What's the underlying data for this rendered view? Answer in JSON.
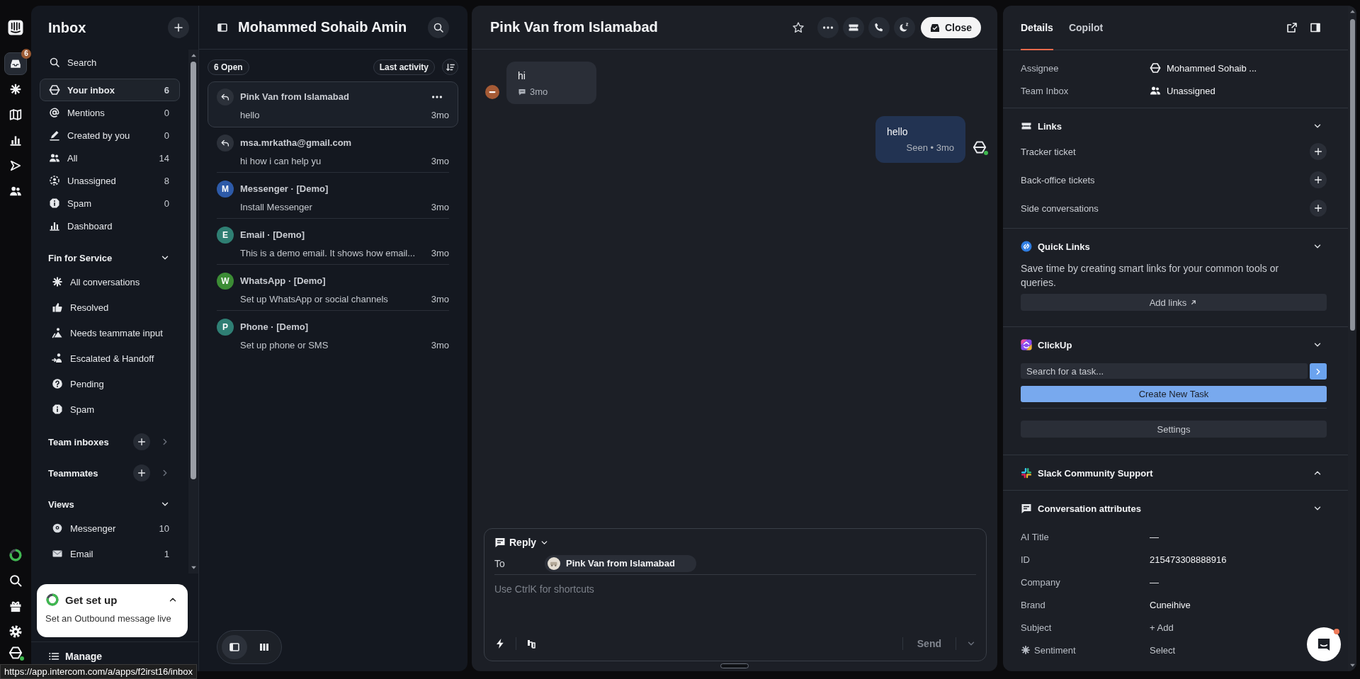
{
  "rail": {
    "top": [
      {
        "selected": true,
        "badge": "6"
      },
      {
        "selected": false
      },
      {
        "selected": false
      },
      {
        "selected": false
      },
      {
        "selected": false
      },
      {
        "selected": false
      }
    ]
  },
  "sidebar": {
    "title": "Inbox",
    "search": "Search",
    "items": [
      {
        "label": "Your inbox",
        "count": "6",
        "selected": true
      },
      {
        "label": "Mentions",
        "count": "0",
        "selected": false
      },
      {
        "label": "Created by you",
        "count": "0",
        "selected": false
      },
      {
        "label": "All",
        "count": "14",
        "selected": false
      },
      {
        "label": "Unassigned",
        "count": "8",
        "selected": false
      },
      {
        "label": "Spam",
        "count": "0",
        "selected": false
      },
      {
        "label": "Dashboard",
        "selected": false
      }
    ],
    "sections": [
      {
        "title": "Fin for Service",
        "kind": "group",
        "expanded": true,
        "items": [
          {
            "label": "All conversations",
            "selected": false
          },
          {
            "label": "Resolved",
            "selected": false
          },
          {
            "label": "Needs teammate input",
            "selected": false
          },
          {
            "label": "Escalated & Handoff",
            "selected": false
          },
          {
            "label": "Pending",
            "selected": false
          },
          {
            "label": "Spam",
            "selected": false
          }
        ]
      },
      {
        "title": "Team inboxes",
        "kind": "addable",
        "expanded": false
      },
      {
        "title": "Teammates",
        "kind": "addable",
        "expanded": false
      },
      {
        "title": "Views",
        "kind": "group",
        "expanded": true,
        "items": [
          {
            "label": "Messenger",
            "count": "10",
            "selected": false
          },
          {
            "label": "Email",
            "count": "1",
            "selected": false
          }
        ]
      }
    ],
    "setup_card": {
      "title": "Get set up",
      "text": "Set an Outbound message live"
    },
    "manage": "Manage"
  },
  "list": {
    "title": "Mohammed Sohaib Amin",
    "open_count": "6 Open",
    "sort": "Last activity",
    "conversations": [
      {
        "kind": "reply",
        "title": "Pink Van from Islamabad",
        "preview": "hello",
        "time": "3mo",
        "selected": true
      },
      {
        "kind": "reply",
        "title": "msa.mrkatha@gmail.com",
        "preview": "hi how i can help yu",
        "time": "3mo",
        "selected": false
      },
      {
        "kind": "initial",
        "initial": "M",
        "color": "#2d5aa8",
        "title": "Messenger · [Demo]",
        "preview": "Install Messenger",
        "time": "3mo",
        "selected": false
      },
      {
        "kind": "initial",
        "initial": "E",
        "color": "#2f7f73",
        "title": "Email · [Demo]",
        "preview": "This is a demo email. It shows how email...",
        "time": "3mo",
        "selected": false
      },
      {
        "kind": "initial",
        "initial": "W",
        "color": "#3c8c35",
        "title": "WhatsApp · [Demo]",
        "preview": "Set up WhatsApp or social channels",
        "time": "3mo",
        "selected": false
      },
      {
        "kind": "initial",
        "initial": "P",
        "color": "#2f7f74",
        "title": "Phone · [Demo]",
        "preview": "Set up phone or SMS",
        "time": "3mo",
        "selected": false
      }
    ],
    "view_mode": [
      {
        "selected": true
      },
      {
        "selected": false
      }
    ]
  },
  "conversation": {
    "title": "Pink Van from Islamabad",
    "starred": false,
    "close": "Close",
    "messages": [
      {
        "kind": "incoming",
        "text": "hi",
        "meta": "3mo"
      },
      {
        "kind": "outgoing",
        "text": "hello",
        "meta": "Seen • 3mo"
      }
    ],
    "composer": {
      "mode": "Reply",
      "to_label": "To",
      "recipient": "Pink Van from Islamabad",
      "placeholder": "Use CtrlK for shortcuts",
      "send": "Send"
    }
  },
  "details": {
    "tabs": [
      {
        "label": "Details",
        "selected": true
      },
      {
        "label": "Copilot",
        "selected": false
      }
    ],
    "people": [
      {
        "label": "Assignee",
        "value": "Mohammed Sohaib ...",
        "kind": "teammate"
      },
      {
        "label": "Team Inbox",
        "value": "Unassigned",
        "kind": "team"
      }
    ],
    "sections": [
      {
        "kind": "links",
        "title": "Links",
        "expanded": true,
        "rows": [
          "Tracker ticket",
          "Back-office tickets",
          "Side conversations"
        ]
      },
      {
        "kind": "quick_links",
        "title": "Quick Links",
        "expanded": true,
        "text": "Save time by creating smart links for your common tools or queries.",
        "button": "Add links"
      },
      {
        "kind": "clickup",
        "title": "ClickUp",
        "expanded": true,
        "search_placeholder": "Search for a task...",
        "create": "Create New Task",
        "settings": "Settings"
      },
      {
        "kind": "slack",
        "title": "Slack Community Support",
        "expanded": false
      },
      {
        "kind": "attributes",
        "title": "Conversation attributes",
        "expanded": true,
        "rows": [
          {
            "label": "AI Title",
            "value": "—",
            "kind": "text",
            "ai": false
          },
          {
            "label": "ID",
            "value": "215473308888916",
            "kind": "text",
            "ai": false
          },
          {
            "label": "Company",
            "value": "—",
            "kind": "text",
            "ai": false
          },
          {
            "label": "Brand",
            "value": "Cuneihive",
            "kind": "text",
            "ai": false
          },
          {
            "label": "Subject",
            "value": "+ Add",
            "kind": "add",
            "ai": false
          },
          {
            "label": "Sentiment",
            "value": "Select",
            "kind": "select",
            "ai": true
          }
        ]
      }
    ]
  },
  "status_url": "https://app.intercom.com/a/apps/f2irst16/inbox"
}
